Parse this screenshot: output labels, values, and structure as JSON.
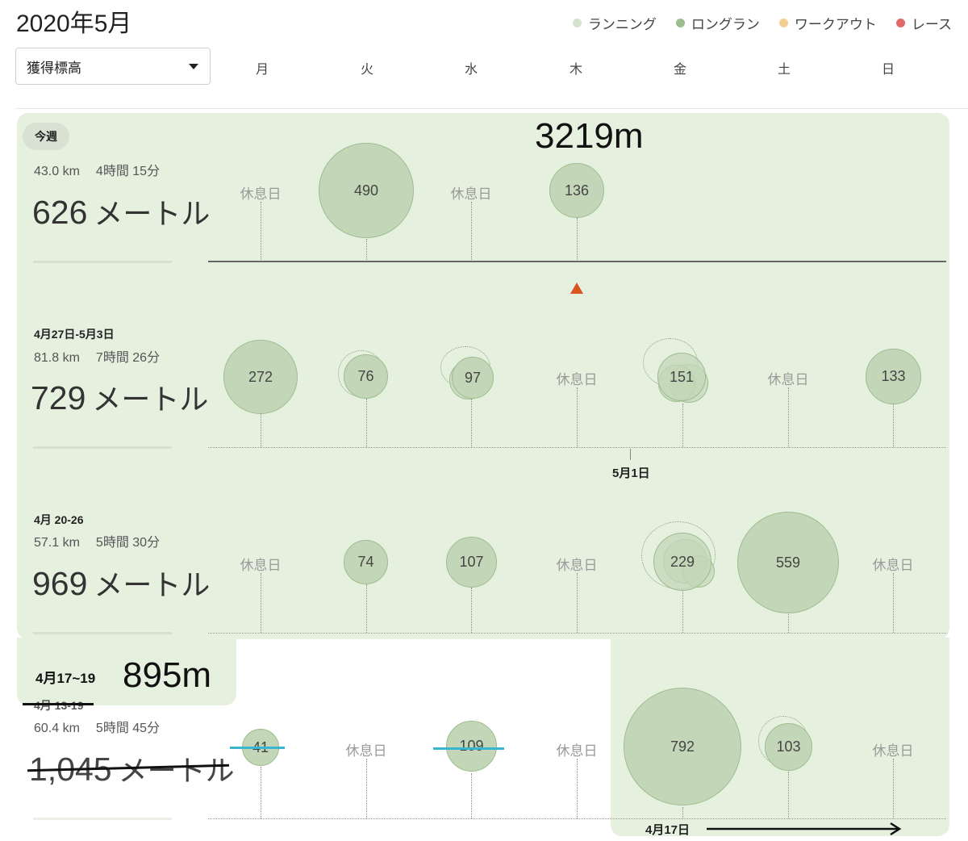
{
  "header": {
    "title": "2020年5月",
    "select_value": "獲得標高",
    "days": [
      "月",
      "火",
      "水",
      "木",
      "金",
      "土",
      "日"
    ]
  },
  "legend": [
    {
      "label": "ランニング",
      "color": "#d4e3cb"
    },
    {
      "label": "ロングラン",
      "color": "#9dbd8f"
    },
    {
      "label": "ワークアウト",
      "color": "#f3cf94"
    },
    {
      "label": "レース",
      "color": "#e06a6a"
    }
  ],
  "rest_label": "休息日",
  "weeks": [
    {
      "chip": "今週",
      "distance": "43.0 km",
      "time": "4時間 15分",
      "elevation": "626",
      "unit": "メートル",
      "annotation": "3219m",
      "days": [
        {
          "day": "月",
          "rest": true
        },
        {
          "day": "火",
          "value": "490"
        },
        {
          "day": "水",
          "rest": true
        },
        {
          "day": "木",
          "value": "136"
        }
      ]
    },
    {
      "label": "4月27日-5月3日",
      "distance": "81.8 km",
      "time": "7時間 26分",
      "elevation": "729",
      "unit": "メートル",
      "date_marker": "5月1日",
      "days": [
        {
          "day": "月",
          "value": "272"
        },
        {
          "day": "火",
          "value": "76"
        },
        {
          "day": "水",
          "value": "97"
        },
        {
          "day": "木",
          "rest": true
        },
        {
          "day": "金",
          "value": "151"
        },
        {
          "day": "土",
          "rest": true
        },
        {
          "day": "日",
          "value": "133"
        }
      ]
    },
    {
      "label": "4月 20-26",
      "distance": "57.1 km",
      "time": "5時間 30分",
      "elevation": "969",
      "unit": "メートル",
      "days": [
        {
          "day": "月",
          "rest": true
        },
        {
          "day": "火",
          "value": "74"
        },
        {
          "day": "水",
          "value": "107"
        },
        {
          "day": "木",
          "rest": true
        },
        {
          "day": "金",
          "value": "229"
        },
        {
          "day": "土",
          "value": "559"
        },
        {
          "day": "日",
          "rest": true
        }
      ]
    },
    {
      "label": "4月 13-19",
      "distance": "60.4 km",
      "time": "5時間 45分",
      "elevation": "1,045",
      "unit": "メートル",
      "annotation_label": "4月17~19",
      "annotation_value": "895m",
      "date_marker": "4月17日",
      "days": [
        {
          "day": "月",
          "value": "41"
        },
        {
          "day": "火",
          "rest": true
        },
        {
          "day": "水",
          "value": "109"
        },
        {
          "day": "木",
          "rest": true
        },
        {
          "day": "金",
          "value": "792"
        },
        {
          "day": "土",
          "value": "103"
        },
        {
          "day": "日",
          "rest": true
        }
      ]
    }
  ]
}
